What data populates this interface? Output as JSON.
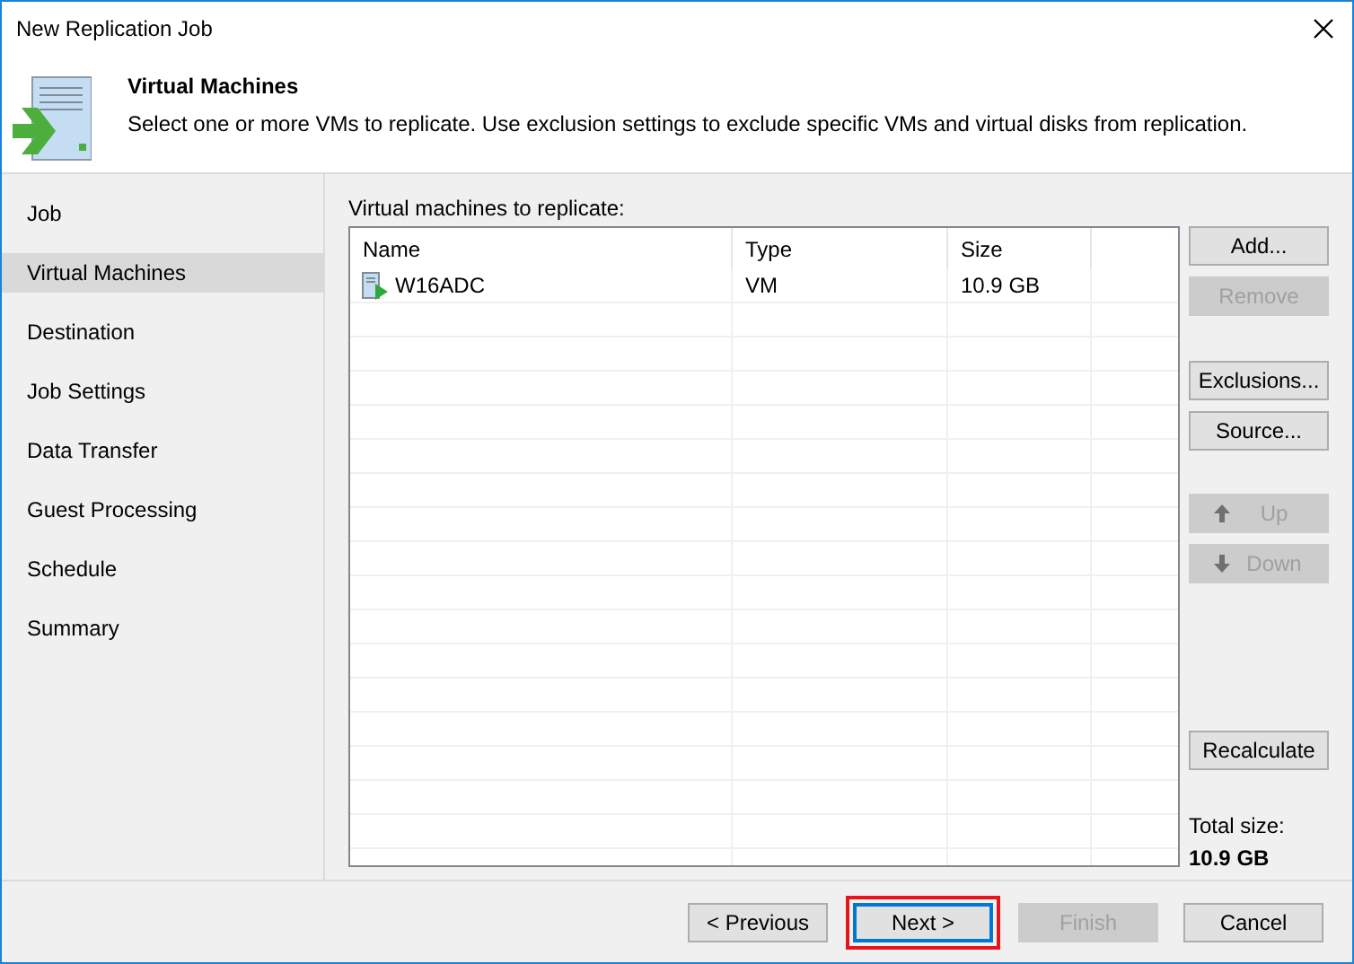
{
  "window": {
    "title": "New Replication Job"
  },
  "header": {
    "title": "Virtual Machines",
    "description": "Select one or more VMs to replicate. Use exclusion settings to exclude specific VMs and virtual disks from replication."
  },
  "sidebar": {
    "items": [
      {
        "label": "Job",
        "selected": false
      },
      {
        "label": "Virtual Machines",
        "selected": true
      },
      {
        "label": "Destination",
        "selected": false
      },
      {
        "label": "Job Settings",
        "selected": false
      },
      {
        "label": "Data Transfer",
        "selected": false
      },
      {
        "label": "Guest Processing",
        "selected": false
      },
      {
        "label": "Schedule",
        "selected": false
      },
      {
        "label": "Summary",
        "selected": false
      }
    ]
  },
  "table": {
    "label": "Virtual machines to replicate:",
    "columns": [
      "Name",
      "Type",
      "Size"
    ],
    "rows": [
      {
        "name": "W16ADC",
        "type": "VM",
        "size": "10.9 GB"
      }
    ]
  },
  "side_buttons": [
    {
      "label": "Add...",
      "disabled": false,
      "kind": "plain"
    },
    {
      "label": "Remove",
      "disabled": true,
      "kind": "plain"
    },
    {
      "label": "Exclusions...",
      "disabled": false,
      "kind": "plain"
    },
    {
      "label": "Source...",
      "disabled": false,
      "kind": "plain"
    },
    {
      "label": "Up",
      "disabled": true,
      "kind": "up"
    },
    {
      "label": "Down",
      "disabled": true,
      "kind": "down"
    },
    {
      "label": "Recalculate",
      "disabled": false,
      "kind": "plain"
    }
  ],
  "total": {
    "label": "Total size:",
    "value": "10.9 GB"
  },
  "footer_buttons": [
    {
      "label": "< Previous",
      "disabled": false,
      "highlighted": false
    },
    {
      "label": "Next >",
      "disabled": false,
      "highlighted": true
    },
    {
      "label": "Finish",
      "disabled": true,
      "highlighted": false
    },
    {
      "label": "Cancel",
      "disabled": false,
      "highlighted": false
    }
  ]
}
